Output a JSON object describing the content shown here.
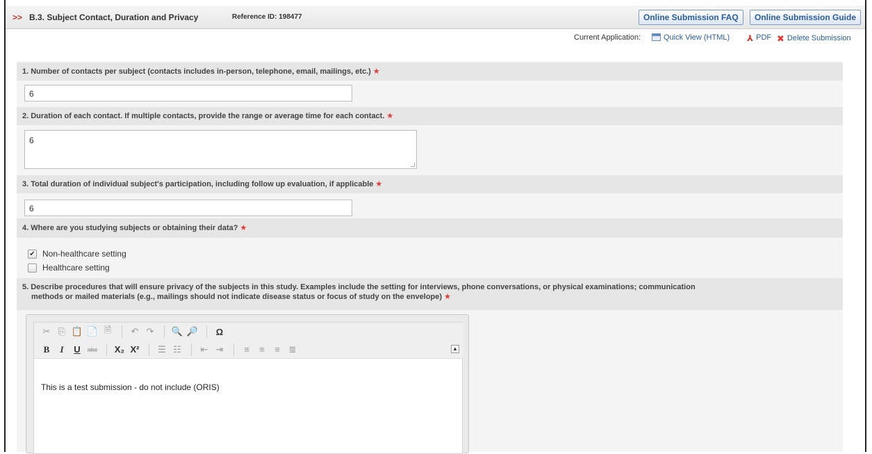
{
  "header": {
    "arrow": ">>",
    "section_title": "B.3. Subject Contact, Duration and Privacy",
    "reference_id": "Reference ID: 198477",
    "faq_button": "Online Submission FAQ",
    "guide_button": "Online Submission Guide"
  },
  "app_bar": {
    "label": "Current Application:",
    "quick_view": "Quick View (HTML)",
    "pdf": "PDF",
    "delete": "Delete Submission"
  },
  "questions": {
    "q1": {
      "label": "1. Number of contacts per subject (contacts includes in-person, telephone, email, mailings, etc.)",
      "value": "6"
    },
    "q2": {
      "label": "2. Duration of each contact. If multiple contacts, provide the range or average time for each contact.",
      "value": "6"
    },
    "q3": {
      "label": "3. Total duration of individual subject's participation, including follow up evaluation, if applicable",
      "value": "6"
    },
    "q4": {
      "label": "4. Where are you studying subjects or obtaining their data?",
      "options": [
        {
          "label": "Non-healthcare setting",
          "checked": true
        },
        {
          "label": "Healthcare setting",
          "checked": false
        }
      ]
    },
    "q5": {
      "label_line1": "5. Describe procedures that will ensure privacy of the subjects in this study. Examples include the setting for interviews, phone conversations, or physical examinations; communication",
      "label_line2": "methods or mailed materials (e.g., mailings should not indicate disease status or focus of study on the envelope)",
      "value": "This is a test submission - do not include (ORIS)"
    }
  },
  "required_mark": "★",
  "editor_toolbar": {
    "row1": [
      "cut-icon",
      "copy-icon",
      "paste-icon",
      "paste-text-icon",
      "paste-word-icon",
      "undo-icon",
      "redo-icon",
      "find-icon",
      "replace-icon",
      "special-char-icon"
    ],
    "row2": [
      "bold-icon",
      "italic-icon",
      "underline-icon",
      "strikethrough-icon",
      "subscript-icon",
      "superscript-icon",
      "numbered-list-icon",
      "bulleted-list-icon",
      "outdent-icon",
      "indent-icon",
      "align-left-icon",
      "align-center-icon",
      "align-right-icon",
      "justify-icon"
    ]
  },
  "colors": {
    "accent_blue": "#2a5d9f",
    "required_red": "#e53935",
    "crumb_red": "#c0392b"
  }
}
